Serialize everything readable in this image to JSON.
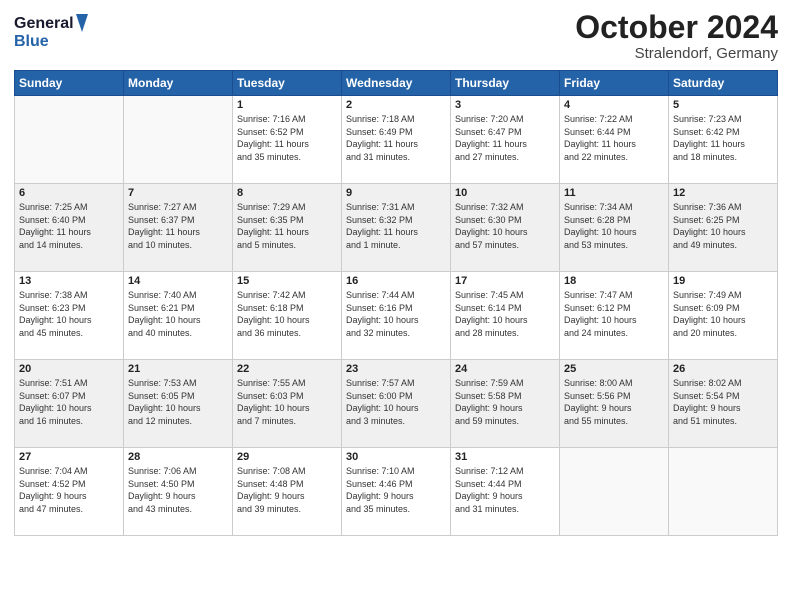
{
  "header": {
    "logo_line1": "General",
    "logo_line2": "Blue",
    "month": "October 2024",
    "location": "Stralendorf, Germany"
  },
  "weekdays": [
    "Sunday",
    "Monday",
    "Tuesday",
    "Wednesday",
    "Thursday",
    "Friday",
    "Saturday"
  ],
  "weeks": [
    [
      {
        "day": "",
        "detail": ""
      },
      {
        "day": "",
        "detail": ""
      },
      {
        "day": "1",
        "detail": "Sunrise: 7:16 AM\nSunset: 6:52 PM\nDaylight: 11 hours\nand 35 minutes."
      },
      {
        "day": "2",
        "detail": "Sunrise: 7:18 AM\nSunset: 6:49 PM\nDaylight: 11 hours\nand 31 minutes."
      },
      {
        "day": "3",
        "detail": "Sunrise: 7:20 AM\nSunset: 6:47 PM\nDaylight: 11 hours\nand 27 minutes."
      },
      {
        "day": "4",
        "detail": "Sunrise: 7:22 AM\nSunset: 6:44 PM\nDaylight: 11 hours\nand 22 minutes."
      },
      {
        "day": "5",
        "detail": "Sunrise: 7:23 AM\nSunset: 6:42 PM\nDaylight: 11 hours\nand 18 minutes."
      }
    ],
    [
      {
        "day": "6",
        "detail": "Sunrise: 7:25 AM\nSunset: 6:40 PM\nDaylight: 11 hours\nand 14 minutes."
      },
      {
        "day": "7",
        "detail": "Sunrise: 7:27 AM\nSunset: 6:37 PM\nDaylight: 11 hours\nand 10 minutes."
      },
      {
        "day": "8",
        "detail": "Sunrise: 7:29 AM\nSunset: 6:35 PM\nDaylight: 11 hours\nand 5 minutes."
      },
      {
        "day": "9",
        "detail": "Sunrise: 7:31 AM\nSunset: 6:32 PM\nDaylight: 11 hours\nand 1 minute."
      },
      {
        "day": "10",
        "detail": "Sunrise: 7:32 AM\nSunset: 6:30 PM\nDaylight: 10 hours\nand 57 minutes."
      },
      {
        "day": "11",
        "detail": "Sunrise: 7:34 AM\nSunset: 6:28 PM\nDaylight: 10 hours\nand 53 minutes."
      },
      {
        "day": "12",
        "detail": "Sunrise: 7:36 AM\nSunset: 6:25 PM\nDaylight: 10 hours\nand 49 minutes."
      }
    ],
    [
      {
        "day": "13",
        "detail": "Sunrise: 7:38 AM\nSunset: 6:23 PM\nDaylight: 10 hours\nand 45 minutes."
      },
      {
        "day": "14",
        "detail": "Sunrise: 7:40 AM\nSunset: 6:21 PM\nDaylight: 10 hours\nand 40 minutes."
      },
      {
        "day": "15",
        "detail": "Sunrise: 7:42 AM\nSunset: 6:18 PM\nDaylight: 10 hours\nand 36 minutes."
      },
      {
        "day": "16",
        "detail": "Sunrise: 7:44 AM\nSunset: 6:16 PM\nDaylight: 10 hours\nand 32 minutes."
      },
      {
        "day": "17",
        "detail": "Sunrise: 7:45 AM\nSunset: 6:14 PM\nDaylight: 10 hours\nand 28 minutes."
      },
      {
        "day": "18",
        "detail": "Sunrise: 7:47 AM\nSunset: 6:12 PM\nDaylight: 10 hours\nand 24 minutes."
      },
      {
        "day": "19",
        "detail": "Sunrise: 7:49 AM\nSunset: 6:09 PM\nDaylight: 10 hours\nand 20 minutes."
      }
    ],
    [
      {
        "day": "20",
        "detail": "Sunrise: 7:51 AM\nSunset: 6:07 PM\nDaylight: 10 hours\nand 16 minutes."
      },
      {
        "day": "21",
        "detail": "Sunrise: 7:53 AM\nSunset: 6:05 PM\nDaylight: 10 hours\nand 12 minutes."
      },
      {
        "day": "22",
        "detail": "Sunrise: 7:55 AM\nSunset: 6:03 PM\nDaylight: 10 hours\nand 7 minutes."
      },
      {
        "day": "23",
        "detail": "Sunrise: 7:57 AM\nSunset: 6:00 PM\nDaylight: 10 hours\nand 3 minutes."
      },
      {
        "day": "24",
        "detail": "Sunrise: 7:59 AM\nSunset: 5:58 PM\nDaylight: 9 hours\nand 59 minutes."
      },
      {
        "day": "25",
        "detail": "Sunrise: 8:00 AM\nSunset: 5:56 PM\nDaylight: 9 hours\nand 55 minutes."
      },
      {
        "day": "26",
        "detail": "Sunrise: 8:02 AM\nSunset: 5:54 PM\nDaylight: 9 hours\nand 51 minutes."
      }
    ],
    [
      {
        "day": "27",
        "detail": "Sunrise: 7:04 AM\nSunset: 4:52 PM\nDaylight: 9 hours\nand 47 minutes."
      },
      {
        "day": "28",
        "detail": "Sunrise: 7:06 AM\nSunset: 4:50 PM\nDaylight: 9 hours\nand 43 minutes."
      },
      {
        "day": "29",
        "detail": "Sunrise: 7:08 AM\nSunset: 4:48 PM\nDaylight: 9 hours\nand 39 minutes."
      },
      {
        "day": "30",
        "detail": "Sunrise: 7:10 AM\nSunset: 4:46 PM\nDaylight: 9 hours\nand 35 minutes."
      },
      {
        "day": "31",
        "detail": "Sunrise: 7:12 AM\nSunset: 4:44 PM\nDaylight: 9 hours\nand 31 minutes."
      },
      {
        "day": "",
        "detail": ""
      },
      {
        "day": "",
        "detail": ""
      }
    ]
  ]
}
